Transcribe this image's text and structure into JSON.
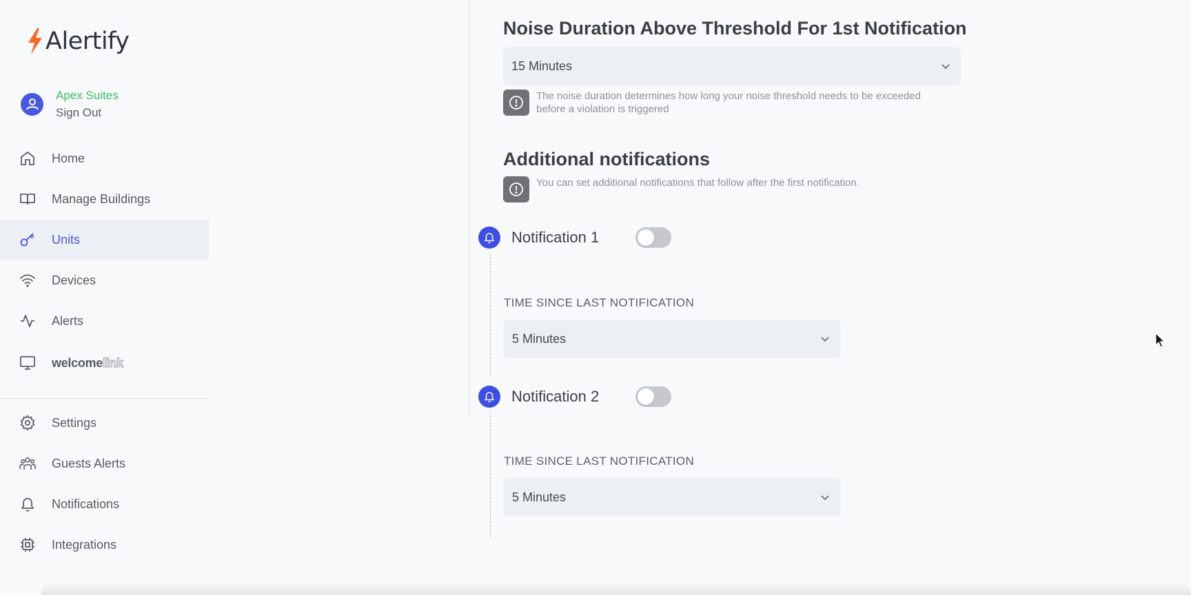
{
  "brand": {
    "name": "Alertify",
    "bolt_color": "#f26b2a"
  },
  "user": {
    "name": "Apex Suites",
    "sign_out": "Sign Out"
  },
  "nav": {
    "items": [
      {
        "label": "Home",
        "icon": "home-icon"
      },
      {
        "label": "Manage Buildings",
        "icon": "book-icon"
      },
      {
        "label": "Units",
        "icon": "key-icon",
        "active": true
      },
      {
        "label": "Devices",
        "icon": "wifi-icon"
      },
      {
        "label": "Alerts",
        "icon": "activity-icon"
      },
      {
        "label_dark": "welcome",
        "label_light": "link",
        "icon": "monitor-icon"
      }
    ],
    "secondary": [
      {
        "label": "Settings",
        "icon": "gear-icon"
      },
      {
        "label": "Guests Alerts",
        "icon": "users-icon"
      },
      {
        "label": "Notifications",
        "icon": "bell-icon"
      },
      {
        "label": "Integrations",
        "icon": "chip-icon"
      }
    ]
  },
  "noise_duration": {
    "title": "Noise Duration Above Threshold For 1st Notification",
    "value": "15 Minutes",
    "info": "The noise duration determines how long your noise threshold needs to be exceeded before a violation is triggered"
  },
  "additional": {
    "title": "Additional notifications",
    "info": "You can set additional notifications that follow after the first notification.",
    "notifications": [
      {
        "label": "Notification 1",
        "enabled": false,
        "field_label": "TIME SINCE LAST NOTIFICATION",
        "value": "5 Minutes"
      },
      {
        "label": "Notification 2",
        "enabled": false,
        "field_label": "TIME SINCE LAST NOTIFICATION",
        "value": "5 Minutes"
      }
    ]
  },
  "colors": {
    "accent": "#4a57e0",
    "user_name": "#3dbb6b",
    "bell_badge": "#3d4ee3"
  }
}
